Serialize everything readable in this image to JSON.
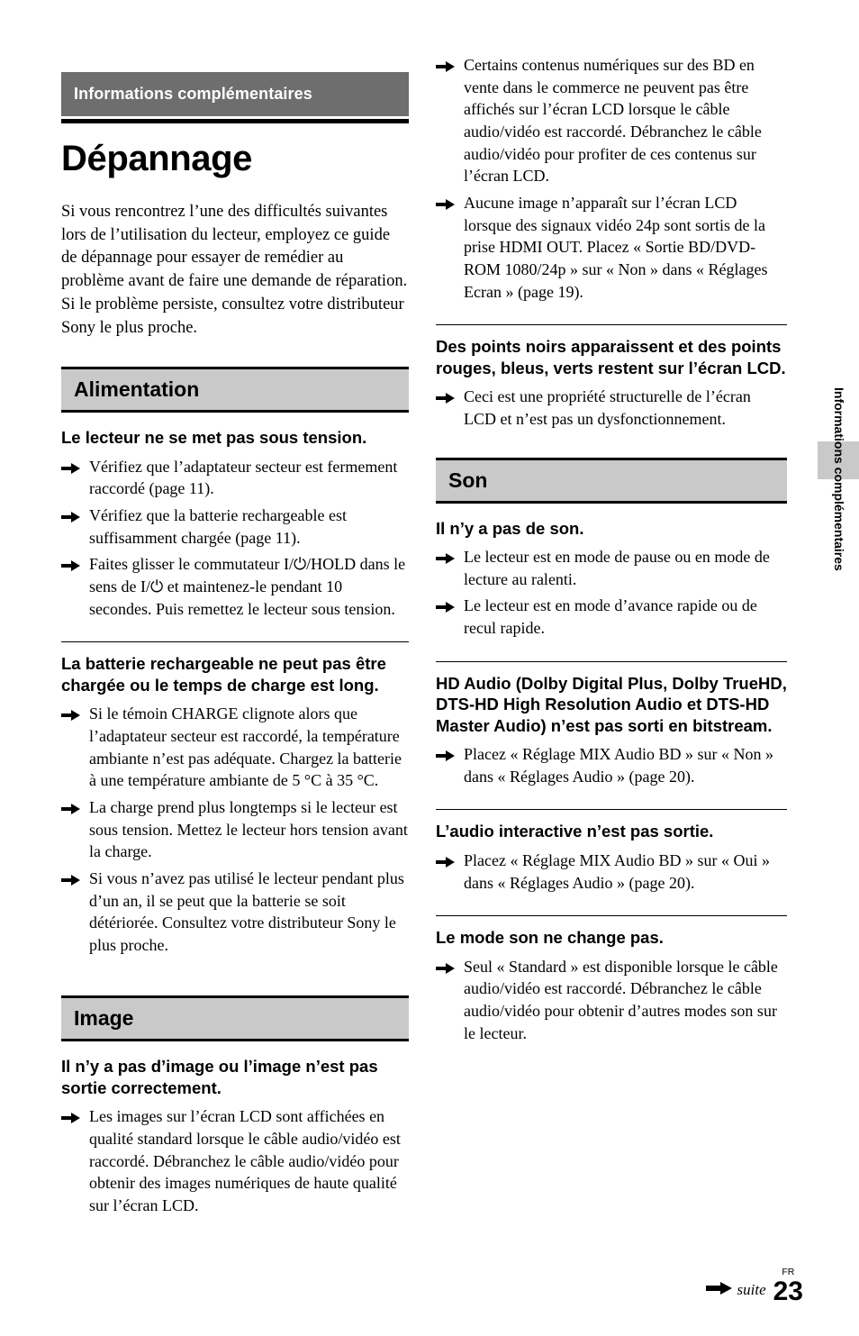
{
  "chapter": {
    "banner_title": "Informations complémentaires",
    "side_tab_label": "Informations complémentaires"
  },
  "title": "Dépannage",
  "intro": "Si vous rencontrez l’une des difficultés suivantes lors de l’utilisation du lecteur, employez ce guide de dépannage pour essayer de remédier au problème avant de faire une demande de réparation. Si le problème persiste, consultez votre distributeur Sony le plus proche.",
  "sections": {
    "alimentation": {
      "bar_label": "Alimentation",
      "blocks": [
        {
          "heading": "Le lecteur ne se met pas sous tension.",
          "ruled": false,
          "items": [
            "Vérifiez que l’adaptateur secteur est fermement raccordé (page 11).",
            "Vérifiez que la batterie rechargeable est suffisamment chargée (page 11).",
            "Faites glisser le commutateur I/⏻/HOLD dans le sens de I/⏻ et maintenez-le pendant 10 secondes. Puis remettez le lecteur sous tension."
          ]
        },
        {
          "heading": "La batterie rechargeable ne peut pas être chargée ou le temps de charge est long.",
          "ruled": true,
          "items": [
            "Si le témoin CHARGE clignote alors que l’adaptateur secteur est raccordé, la température ambiante n’est pas adéquate. Chargez la batterie à une température ambiante de 5 °C à 35 °C.",
            "La charge prend plus longtemps si le lecteur est sous tension. Mettez le lecteur hors tension avant la charge.",
            "Si vous n’avez pas utilisé le lecteur pendant plus d’un an, il se peut que la batterie se soit détériorée. Consultez votre distributeur Sony le plus proche."
          ]
        }
      ]
    },
    "image": {
      "bar_label": "Image",
      "blocks": [
        {
          "heading": "Il n’y a pas d’image ou l’image n’est pas sortie correctement.",
          "ruled": false,
          "items": [
            "Les images sur l’écran LCD sont affichées en qualité standard lorsque le câble audio/vidéo est raccordé. Débranchez le câble audio/vidéo pour obtenir des images numériques de haute qualité sur l’écran LCD.",
            "Certains contenus numériques sur des BD en vente dans le commerce ne peuvent pas être affichés sur l’écran LCD lorsque le câble audio/vidéo est raccordé. Débranchez le câble audio/vidéo pour profiter de ces contenus sur l’écran LCD.",
            "Aucune image n’apparaît sur l’écran LCD lorsque des signaux vidéo 24p sont sortis de la prise HDMI OUT. Placez « Sortie BD/DVD-ROM 1080/24p » sur « Non » dans « Réglages Ecran » (page 19)."
          ]
        },
        {
          "heading": "Des points noirs apparaissent et des points rouges, bleus, verts restent sur l’écran LCD.",
          "ruled": true,
          "items": [
            "Ceci est une propriété structurelle de l’écran LCD et n’est pas un dysfonctionnement."
          ]
        }
      ]
    },
    "son": {
      "bar_label": "Son",
      "blocks": [
        {
          "heading": "Il n’y a pas de son.",
          "ruled": false,
          "items": [
            "Le lecteur est en mode de pause ou en mode de lecture au ralenti.",
            "Le lecteur est en mode d’avance rapide ou de recul rapide."
          ]
        },
        {
          "heading": "HD Audio (Dolby Digital Plus, Dolby TrueHD, DTS-HD High Resolution Audio et DTS-HD Master Audio) n’est pas sorti en bitstream.",
          "ruled": true,
          "items": [
            "Placez « Réglage MIX Audio BD » sur « Non » dans « Réglages Audio » (page 20)."
          ]
        },
        {
          "heading": "L’audio interactive n’est pas sortie.",
          "ruled": true,
          "items": [
            "Placez « Réglage MIX Audio BD » sur « Oui » dans « Réglages Audio » (page 20)."
          ]
        },
        {
          "heading": "Le mode son ne change pas.",
          "ruled": true,
          "items": [
            "Seul « Standard » est disponible lorsque le câble audio/vidéo est raccordé. Débranchez le câble audio/vidéo pour obtenir d’autres modes son sur le lecteur."
          ]
        }
      ]
    }
  },
  "footer": {
    "continue_label": "suite",
    "language_code": "FR",
    "page_number": "23"
  },
  "colors": {
    "banner_bg": "#6e6e6e",
    "section_bar_bg": "#c9c9c9",
    "text": "#000000"
  },
  "icons": {
    "arrow": "arrow-right-bullet-icon",
    "continue_arrow": "continue-arrow-icon"
  }
}
